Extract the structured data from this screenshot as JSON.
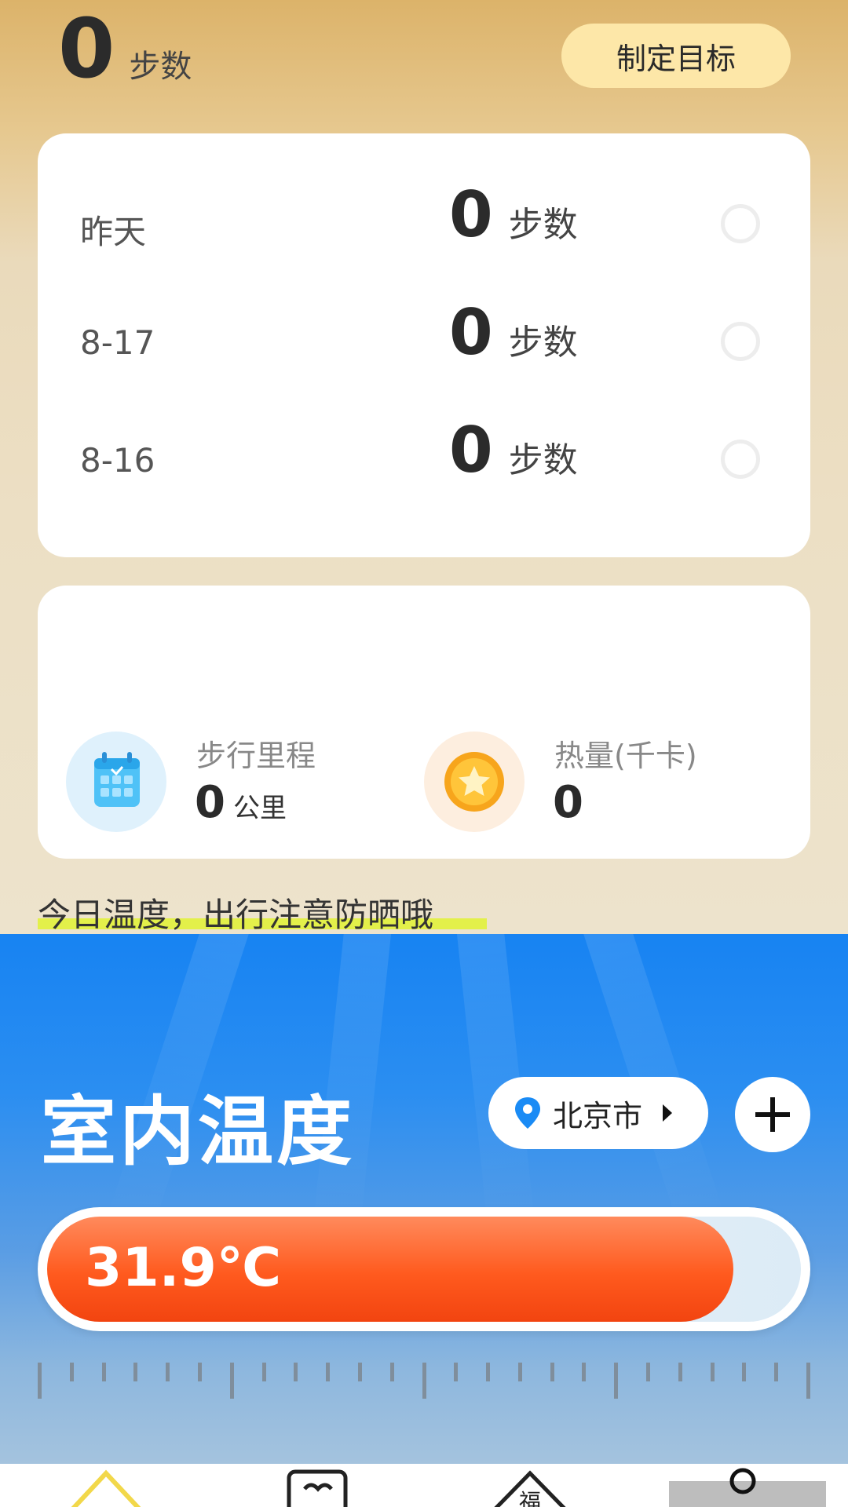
{
  "header": {
    "today_steps": "0",
    "steps_unit": "步数",
    "goal_button": "制定目标"
  },
  "history": [
    {
      "date": "昨天",
      "steps": "0",
      "unit": "步数"
    },
    {
      "date": "8-17",
      "steps": "0",
      "unit": "步数"
    },
    {
      "date": "8-16",
      "steps": "0",
      "unit": "步数"
    }
  ],
  "stats": {
    "distance": {
      "label": "步行里程",
      "value": "0",
      "unit": "公里",
      "icon": "calendar-icon"
    },
    "calories": {
      "label": "热量(千卡)",
      "value": "0",
      "icon": "coin-star-icon"
    }
  },
  "tip": "今日温度，出行注意防晒哦",
  "weather": {
    "title": "室内温度",
    "city": "北京市",
    "temperature": "31.9℃",
    "temperature_fraction": 0.91,
    "colors": {
      "accent_blue": "#1783f2",
      "thermo_red": "#f24410"
    }
  },
  "nav": {
    "items": [
      "home-icon",
      "heart-frame-icon",
      "fortune-icon",
      "profile-icon"
    ]
  }
}
